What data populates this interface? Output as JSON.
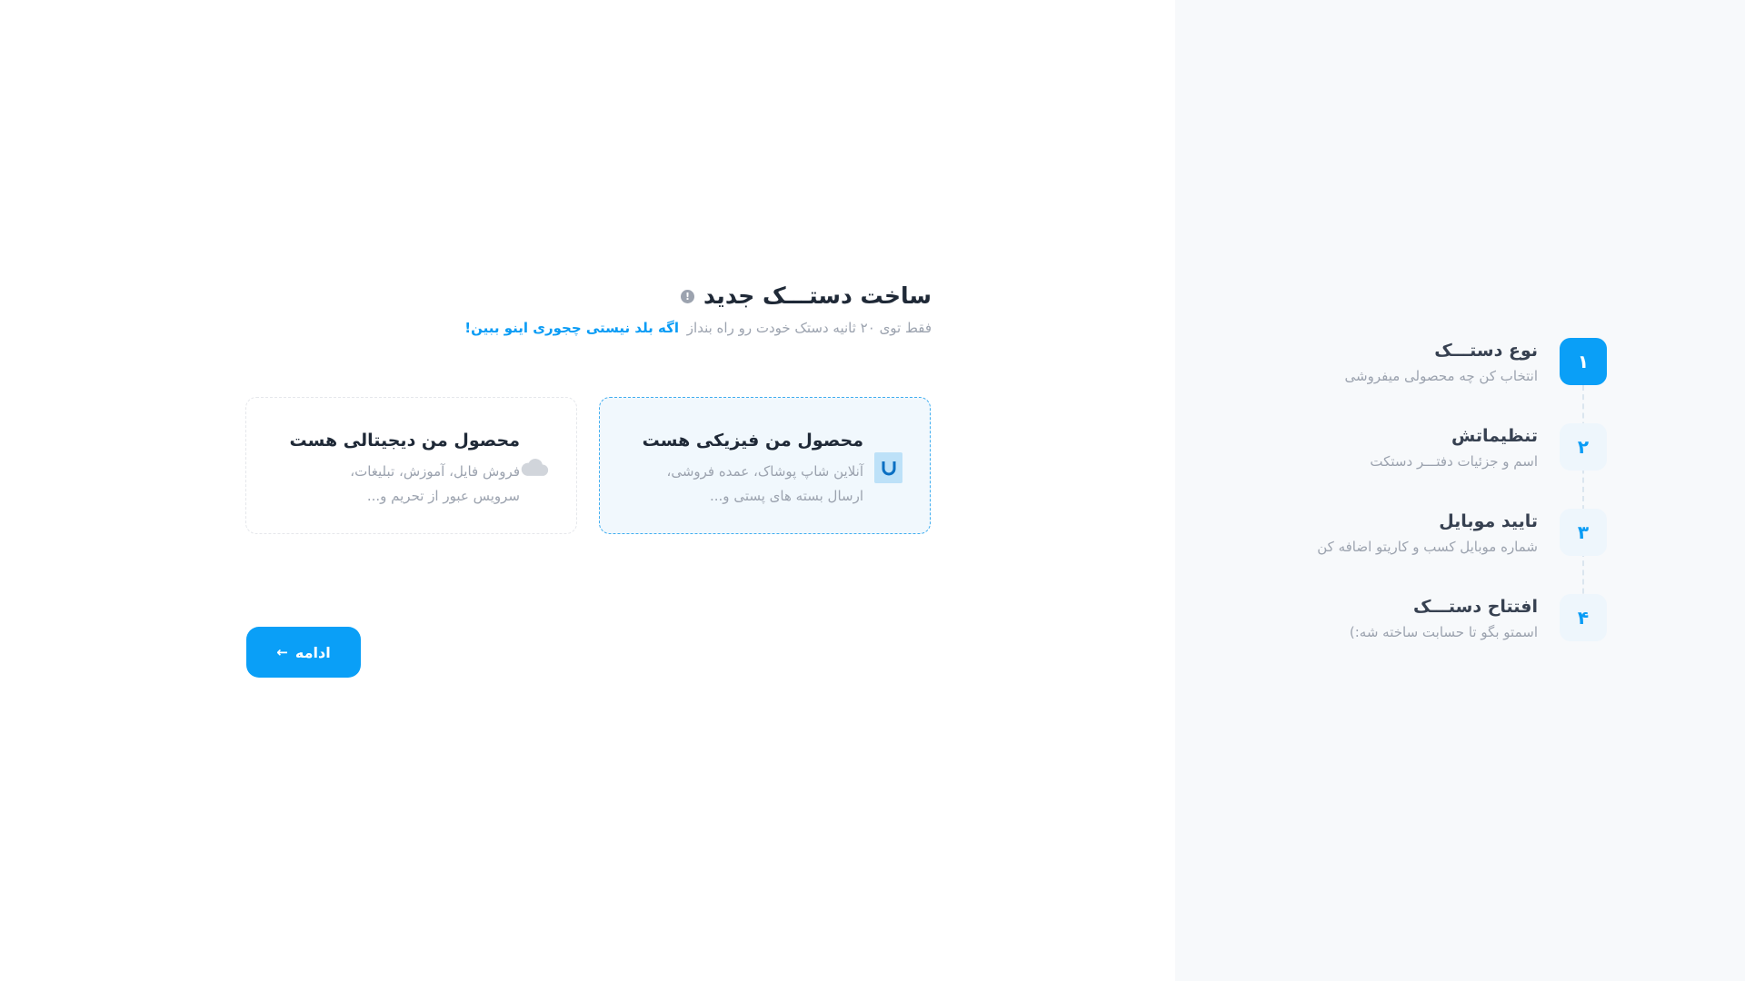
{
  "main": {
    "title": "ساخت دستـــک جدید",
    "info_icon": "!",
    "subtitle": "فقط توی ۲۰ ثانیه دستک خودت رو راه بنداز",
    "help_link": "اگه بلد نیستی چجوری اینو ببین!",
    "cards": [
      {
        "title": "محصول من فیزیکی هست",
        "description": "آنلاین شاپ پوشاک، عمده فروشی، ارسال بسته های پستی و...",
        "icon": "magnet-icon",
        "selected": true
      },
      {
        "title": "محصول من دیجیتالی هست",
        "description": "فروش فایل، آموزش، تبلیغات، سرویس عبور از تحریم و...",
        "icon": "cloud-icon",
        "selected": false
      }
    ],
    "continue_label": "ادامه",
    "continue_arrow": "←"
  },
  "stepper": {
    "steps": [
      {
        "number": "۱",
        "title": "نوع دستـــک",
        "subtitle": "انتخاب کن چه محصولی میفروشی",
        "active": true
      },
      {
        "number": "۲",
        "title": "تنظیماتش",
        "subtitle": "اسم و جزئیات دفتـــر دستکت",
        "active": false
      },
      {
        "number": "۳",
        "title": "تایید موبایل",
        "subtitle": "شماره موبایل کسب و کاریتو اضافه کن",
        "active": false
      },
      {
        "number": "۴",
        "title": "افتتاح دستـــک",
        "subtitle": "اسمتو بگو تا حسابت ساخته شه:)",
        "active": false
      }
    ]
  },
  "colors": {
    "accent": "#0a9ff7",
    "sidebar_bg": "#f7f9fb",
    "muted_text": "#9ca3af",
    "selected_card_bg": "#f1f8fd"
  }
}
